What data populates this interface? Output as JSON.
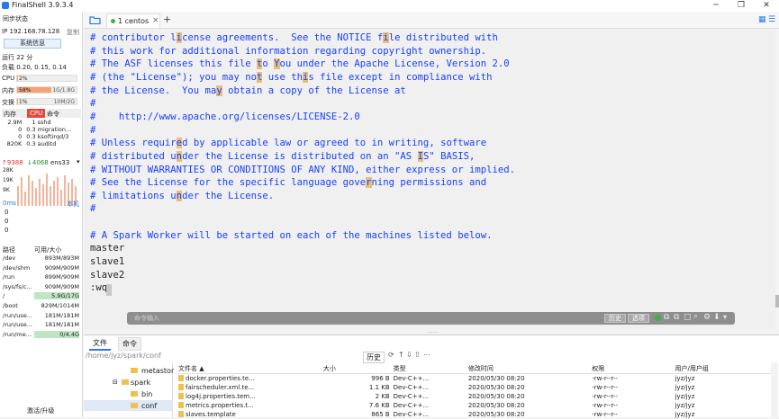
{
  "app": {
    "title": "FinalShell 3.9.3.4",
    "min": "─",
    "max": "❐",
    "close": "✕"
  },
  "sidebar": {
    "sync": "同步状态",
    "ip": "IP 192.168.78.128",
    "copy": "复制",
    "sysinfo": "系统信息",
    "uptime": "运行 22 分",
    "load": "负载 0.20, 0.15, 0.14",
    "cpu_label": "CPU",
    "cpu_val": "2%",
    "cpu_pct": 2,
    "mem_label": "内存",
    "mem_val": "58%",
    "mem_detail": "1G/1.8G",
    "mem_pct": 58,
    "swap_label": "交换",
    "swap_val": "1%",
    "swap_detail": "10M/2G",
    "swap_pct": 1,
    "proc_tabs": [
      "内存",
      "CPU",
      "命令"
    ],
    "procs": [
      [
        "2.9M",
        "1",
        "sshd"
      ],
      [
        "0",
        "0.3",
        "migration..."
      ],
      [
        "0",
        "0.3",
        "ksoftirqd/3"
      ],
      [
        "820K",
        "0.3",
        "auditd"
      ]
    ],
    "net": {
      "up": "↑9388",
      "down": "↓4068",
      "iface": "ens33"
    },
    "net_levels": [
      "28K",
      "19K",
      "9K"
    ],
    "ping": "0ms",
    "local": "本机",
    "ping_vals": [
      "0",
      "0",
      "0"
    ],
    "disk_headers": [
      "路径",
      "可用/大小"
    ],
    "disks": [
      [
        "/dev",
        "893M/893M"
      ],
      [
        "/dev/shm",
        "909M/909M"
      ],
      [
        "/run",
        "899M/909M"
      ],
      [
        "/sys/fs/c...",
        "909M/909M"
      ],
      [
        "/",
        "5.9G/17G"
      ],
      [
        "/boot",
        "829M/1014M"
      ],
      [
        "/run/use...",
        "181M/181M"
      ],
      [
        "/run/use...",
        "181M/181M"
      ],
      [
        "/run/me...",
        "0/4.4G"
      ]
    ],
    "activate": "激活/升级"
  },
  "tabs": {
    "folder_icon": "folder-icon",
    "tab1": "1 centos",
    "close": "×",
    "add": "+"
  },
  "terminal": {
    "lines": [
      "# contributor license agreements.  See the NOTICE file distributed with",
      "# this work for additional information regarding copyright ownership.",
      "# The ASF licenses this file to You under the Apache License, Version 2.0",
      "# (the \"License\"); you may not use this file except in compliance with",
      "# the License.  You may obtain a copy of the License at",
      "#",
      "#    http://www.apache.org/licenses/LICENSE-2.0",
      "#",
      "# Unless required by applicable law or agreed to in writing, software",
      "# distributed under the License is distributed on an \"AS IS\" BASIS,",
      "# WITHOUT WARRANTIES OR CONDITIONS OF ANY KIND, either express or implied.",
      "# See the License for the specific language governing permissions and",
      "# limitations under the License.",
      "#",
      "",
      "# A Spark Worker will be started on each of the machines listed below.",
      "master",
      "slave1",
      "slave2",
      ":wq"
    ]
  },
  "cmdbar": {
    "placeholder": "命令输入",
    "history": "历史",
    "options": "选项"
  },
  "bottom": {
    "tabs": [
      "文件",
      "命令"
    ],
    "path": "/home/jyz/spark/conf",
    "history": "历史",
    "tree": [
      "metastor",
      "spark",
      "bin",
      "conf"
    ],
    "headers": [
      "文件名 ▲",
      "大小",
      "类型",
      "修改时间",
      "权限",
      "用户/用户组"
    ],
    "files": [
      [
        "docker.properties.te...",
        "996 B",
        "Dev-C++...",
        "2020/05/30 08:20",
        "-rw-r--r--",
        "jyz/jyz"
      ],
      [
        "fairscheduler.xml.te...",
        "1.1 KB",
        "Dev-C++...",
        "2020/05/30 08:20",
        "-rw-r--r--",
        "jyz/jyz"
      ],
      [
        "log4j.properties.tem...",
        "2 KB",
        "Dev-C++...",
        "2020/05/30 08:20",
        "-rw-r--r--",
        "jyz/jyz"
      ],
      [
        "metrics.properties.t...",
        "7.6 KB",
        "Dev-C++...",
        "2020/05/30 08:20",
        "-rw-r--r--",
        "jyz/jyz"
      ],
      [
        "slaves.template",
        "865 B",
        "Dev-C++...",
        "2020/05/30 08:20",
        "-rw-r--r--",
        "jyz/jyz"
      ]
    ]
  }
}
